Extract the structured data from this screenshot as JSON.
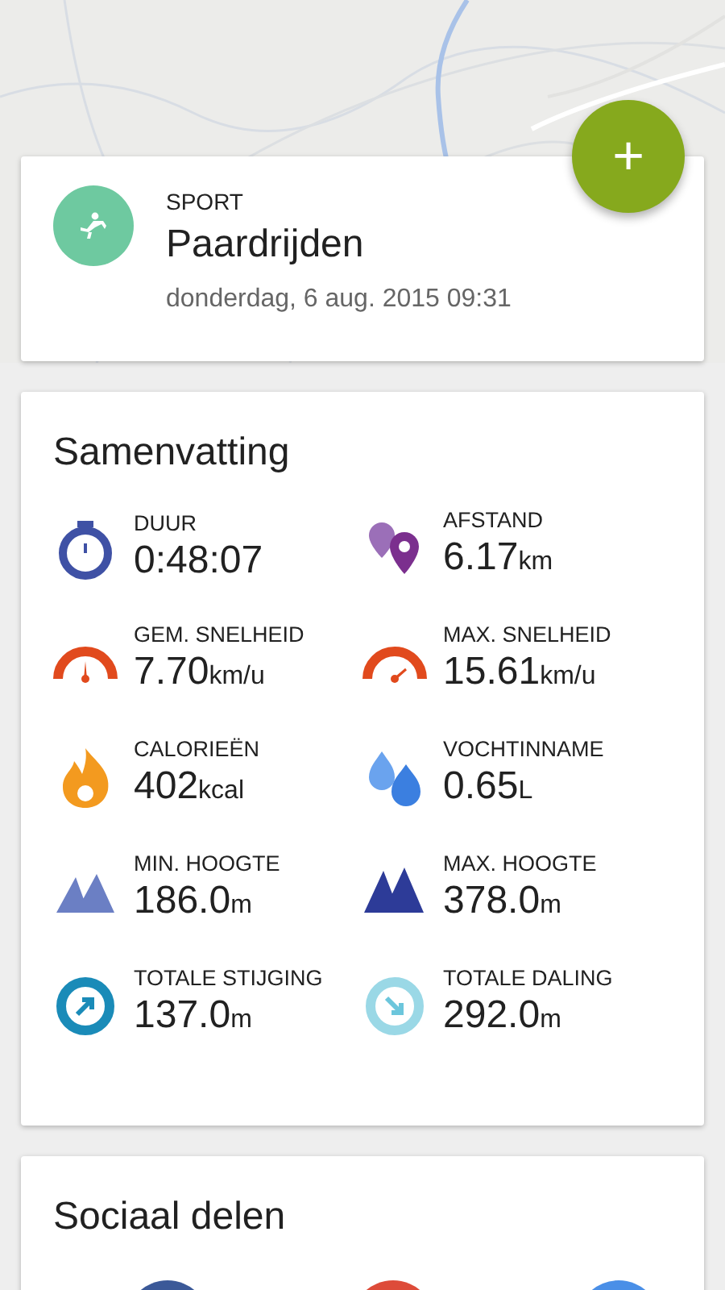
{
  "fab": {
    "label": "+"
  },
  "activity": {
    "category": "SPORT",
    "name": "Paardrijden",
    "datetime": "donderdag, 6 aug. 2015 09:31"
  },
  "summary": {
    "title": "Samenvatting",
    "stats": [
      {
        "kind": "duration",
        "label": "DUUR",
        "value": "0:48:07"
      },
      {
        "kind": "distance",
        "label": "AFSTAND",
        "value": "6.17",
        "unit": "km"
      },
      {
        "kind": "avg_speed",
        "label": "GEM. SNELHEID",
        "value": "7.70",
        "unit": "km/u"
      },
      {
        "kind": "max_speed",
        "label": "MAX. SNELHEID",
        "value": "15.61",
        "unit": "km/u"
      },
      {
        "kind": "calories",
        "label": "CALORIEËN",
        "value": "402",
        "unit": "kcal"
      },
      {
        "kind": "hydration",
        "label": "VOCHTINNAME",
        "value": "0.65",
        "unit": "L"
      },
      {
        "kind": "min_altitude",
        "label": "MIN. HOOGTE",
        "value": "186.0",
        "unit": "m"
      },
      {
        "kind": "max_altitude",
        "label": "MAX. HOOGTE",
        "value": "378.0",
        "unit": "m"
      },
      {
        "kind": "ascent",
        "label": "TOTALE STIJGING",
        "value": "137.0",
        "unit": "m"
      },
      {
        "kind": "descent",
        "label": "TOTALE DALING",
        "value": "292.0",
        "unit": "m"
      }
    ]
  },
  "social": {
    "title": "Sociaal delen",
    "buttons": [
      {
        "color": "#3b5998"
      },
      {
        "color": "#dd4b39"
      },
      {
        "color": "#4a8fe7"
      }
    ]
  }
}
